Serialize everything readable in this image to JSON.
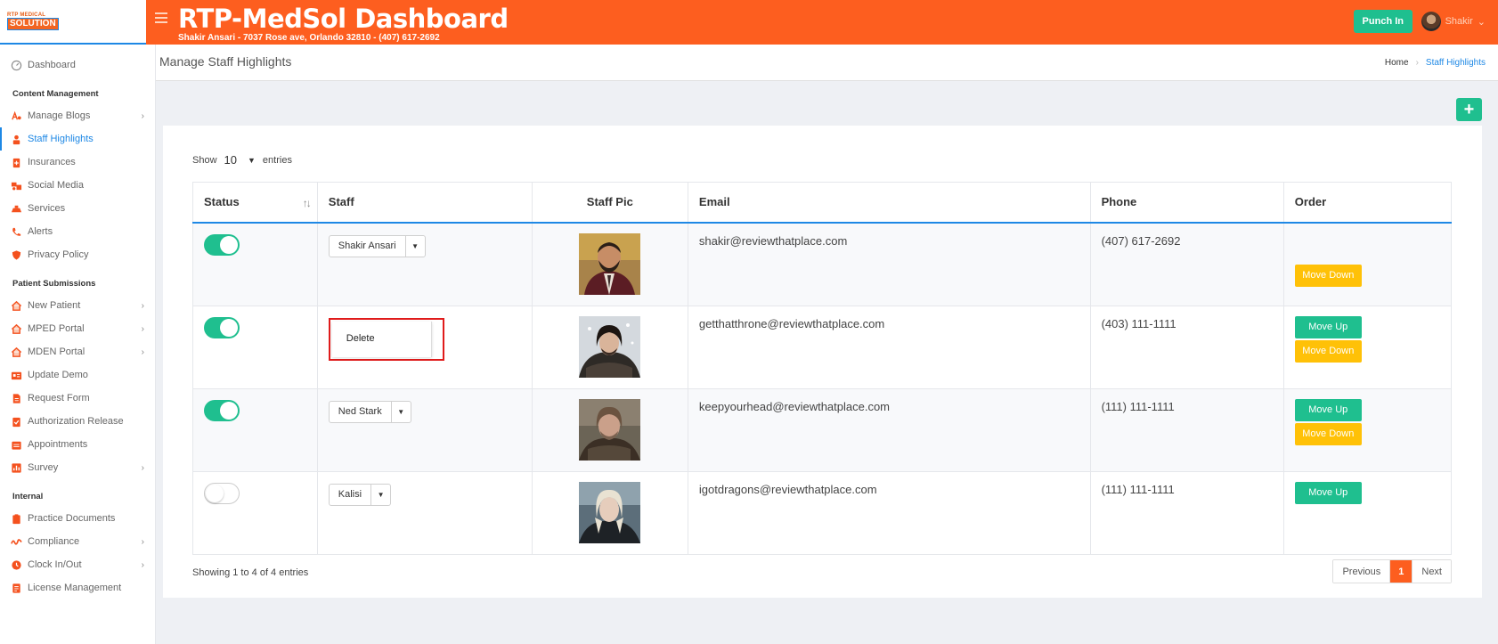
{
  "brand": {
    "logo_line1": "RTP MEDICAL",
    "logo_line2": "SOLUTION"
  },
  "header": {
    "title": "RTP-MedSol Dashboard",
    "subtitle": "Shakir Ansari - 7037 Rose ave, Orlando 32810 - (407) 617-2692",
    "punch_label": "Punch In",
    "user_name": "Shakir"
  },
  "sidebar": {
    "top": [
      {
        "label": "Dashboard",
        "icon": "dashboard-icon"
      }
    ],
    "sections": [
      {
        "title": "Content Management",
        "items": [
          {
            "label": "Manage Blogs",
            "icon": "blog-icon",
            "chevron": true
          },
          {
            "label": "Staff Highlights",
            "icon": "staff-icon",
            "active": true
          },
          {
            "label": "Insurances",
            "icon": "insurance-icon"
          },
          {
            "label": "Social Media",
            "icon": "social-icon"
          },
          {
            "label": "Services",
            "icon": "services-icon"
          },
          {
            "label": "Alerts",
            "icon": "phone-icon"
          },
          {
            "label": "Privacy Policy",
            "icon": "shield-icon"
          }
        ]
      },
      {
        "title": "Patient Submissions",
        "items": [
          {
            "label": "New Patient",
            "icon": "home-icon",
            "chevron": true
          },
          {
            "label": "MPED Portal",
            "icon": "home-icon",
            "chevron": true
          },
          {
            "label": "MDEN Portal",
            "icon": "home-icon",
            "chevron": true
          },
          {
            "label": "Update Demo",
            "icon": "id-card-icon"
          },
          {
            "label": "Request Form",
            "icon": "document-icon"
          },
          {
            "label": "Authorization Release",
            "icon": "check-doc-icon"
          },
          {
            "label": "Appointments",
            "icon": "calendar-icon"
          },
          {
            "label": "Survey",
            "icon": "chart-icon",
            "chevron": true
          }
        ]
      },
      {
        "title": "Internal",
        "items": [
          {
            "label": "Practice Documents",
            "icon": "clipboard-icon"
          },
          {
            "label": "Compliance",
            "icon": "signature-icon",
            "chevron": true
          },
          {
            "label": "Clock In/Out",
            "icon": "clock-icon",
            "chevron": true
          },
          {
            "label": "License Management",
            "icon": "license-icon"
          }
        ]
      }
    ]
  },
  "page": {
    "title": "Manage Staff Highlights",
    "breadcrumb_home": "Home",
    "breadcrumb_current": "Staff Highlights",
    "add_label": "+"
  },
  "table": {
    "show_label": "Show",
    "page_size": "10",
    "entries_label": "entries",
    "columns": [
      "Status",
      "Staff",
      "Staff Pic",
      "Email",
      "Phone",
      "Order"
    ],
    "rows": [
      {
        "status_on": true,
        "staff": "Shakir Ansari",
        "email": "shakir@reviewthatplace.com",
        "phone": "(407) 617-2692",
        "move_up": "",
        "move_down": "Move Down"
      },
      {
        "status_on": true,
        "staff": "",
        "dropdown_item": "Delete",
        "email": "getthatthrone@reviewthatplace.com",
        "phone": "(403) 111-1111",
        "move_up": "Move Up",
        "move_down": "Move Down"
      },
      {
        "status_on": true,
        "staff": "Ned Stark",
        "email": "keepyourhead@reviewthatplace.com",
        "phone": "(111) 111-1111",
        "move_up": "Move Up",
        "move_down": "Move Down"
      },
      {
        "status_on": false,
        "staff": "Kalisi",
        "email": "igotdragons@reviewthatplace.com",
        "phone": "(111) 111-1111",
        "move_up": "Move Up",
        "move_down": ""
      }
    ],
    "showing_text": "Showing 1 to 4 of 4 entries",
    "pager": {
      "previous": "Previous",
      "current": "1",
      "next": "Next"
    }
  },
  "colors": {
    "brand_orange": "#fd5e1f",
    "accent_green": "#1fbf8f",
    "warning_yellow": "#ffc107",
    "link_blue": "#1e88e5"
  }
}
